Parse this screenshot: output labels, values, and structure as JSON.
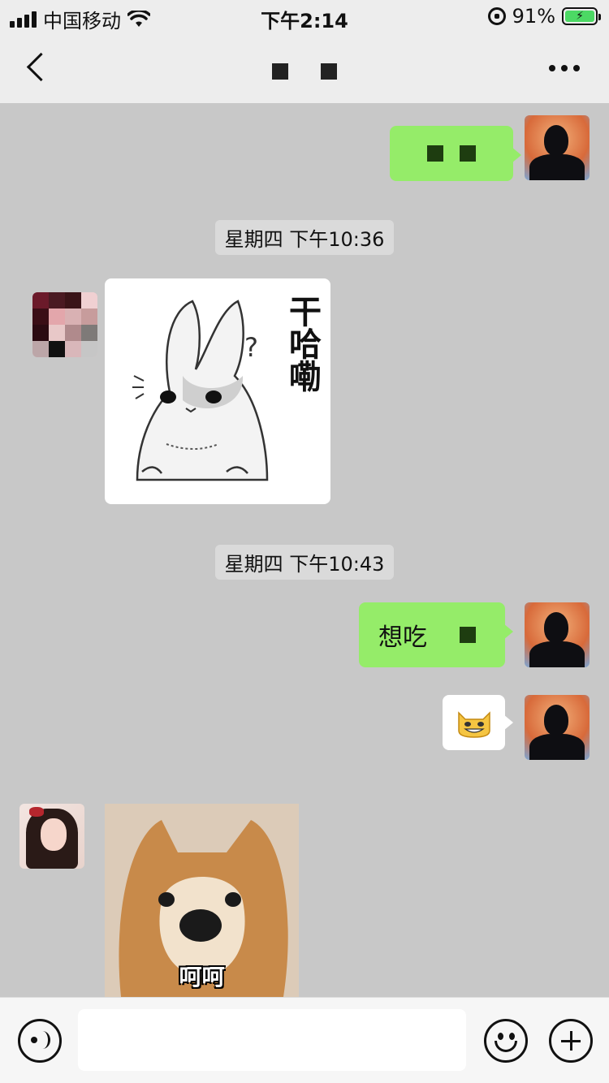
{
  "status_bar": {
    "carrier": "中国移动",
    "time": "下午2:14",
    "battery_percent": "91%",
    "battery_level": 0.91,
    "icons": [
      "signal-icon",
      "wifi-icon",
      "rotation-lock-icon",
      "battery-charging-icon"
    ]
  },
  "header": {
    "back_icon": "chevron-left-icon",
    "more_icon": "more-dots-icon"
  },
  "timestamps": [
    "星期四 下午10:36",
    "星期四 下午10:43"
  ],
  "messages": {
    "sent_1": {
      "text": ""
    },
    "received_sticker_rabbit": {
      "text": "干哈嘞",
      "mark": "?"
    },
    "sent_2": {
      "text": "想吃"
    },
    "sent_emoji": {
      "icon": "grinning-cat-emoji"
    },
    "received_dog": {
      "caption": "呵呵"
    }
  },
  "input_bar": {
    "voice_icon": "voice-icon",
    "emoji_icon": "emoji-icon",
    "plus_icon": "plus-icon",
    "input_placeholder": ""
  },
  "colors": {
    "sent_bubble": "#95ec69",
    "chat_background": "#c8c8c8",
    "header_background": "#ededed"
  }
}
